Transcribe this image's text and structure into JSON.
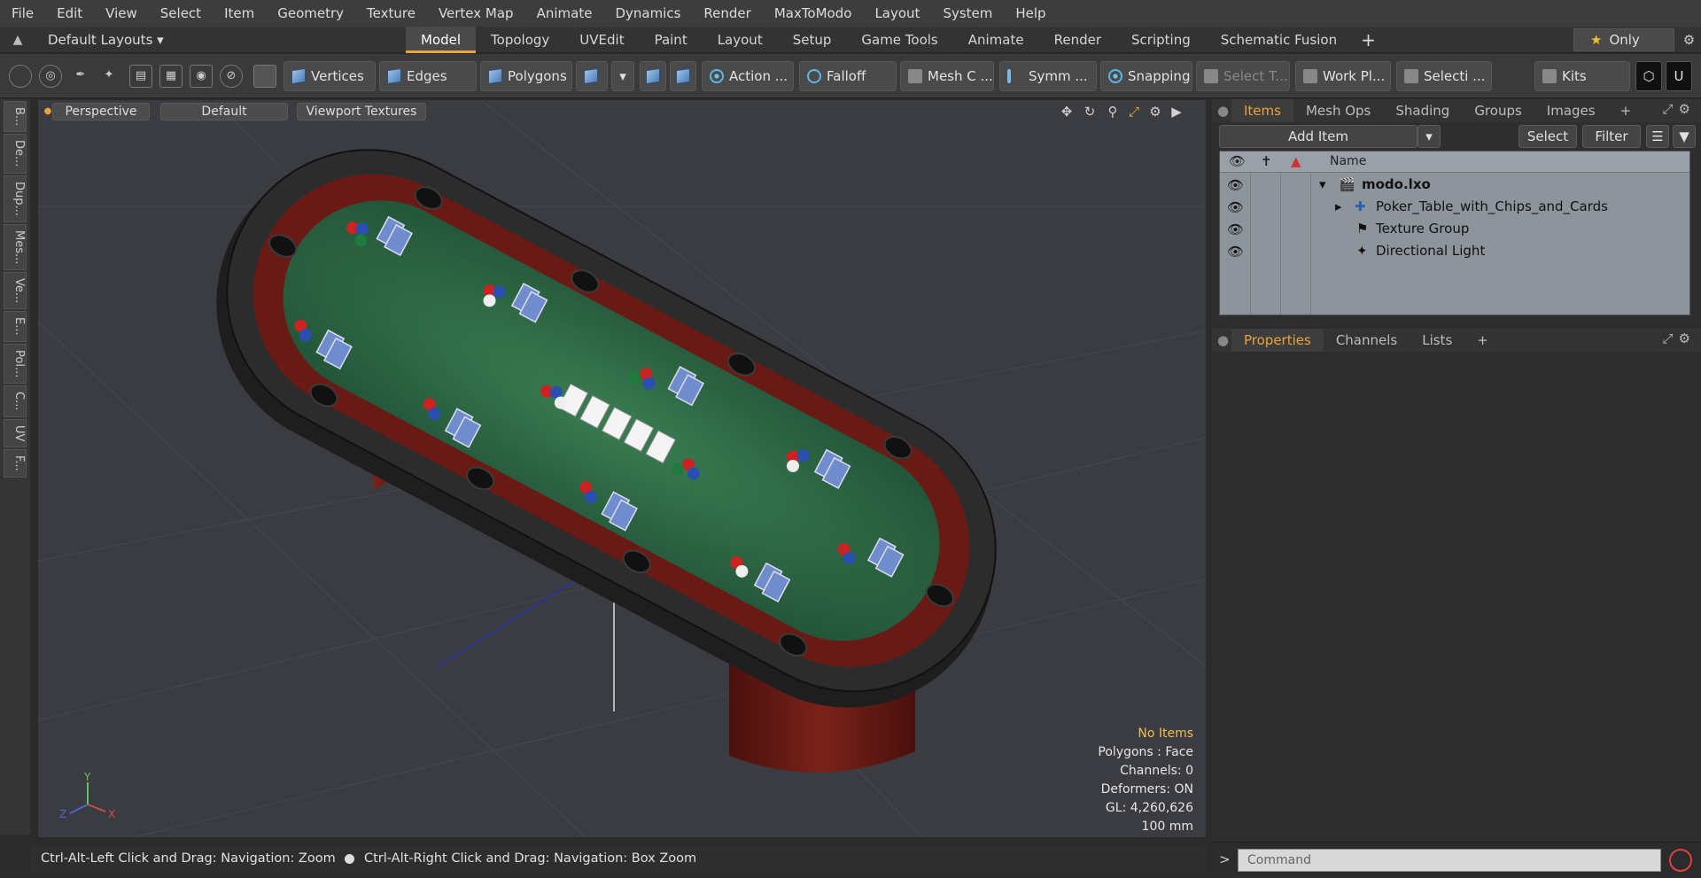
{
  "menu": [
    "File",
    "Edit",
    "View",
    "Select",
    "Item",
    "Geometry",
    "Texture",
    "Vertex Map",
    "Animate",
    "Dynamics",
    "Render",
    "MaxToModo",
    "Layout",
    "System",
    "Help"
  ],
  "layoutbar": {
    "layouts_label": "Default Layouts ▾",
    "tabs": [
      "Model",
      "Topology",
      "UVEdit",
      "Paint",
      "Layout",
      "Setup",
      "Game Tools",
      "Animate",
      "Render",
      "Scripting",
      "Schematic Fusion"
    ],
    "active_tab": "Model",
    "only_label": "Only"
  },
  "toolbar": {
    "vertices": "Vertices",
    "edges": "Edges",
    "polygons": "Polygons",
    "action": "Action",
    "falloff": "Falloff",
    "meshc": "Mesh C ...",
    "symm": "Symm ...",
    "snapping": "Snapping",
    "selectt": "Select T...",
    "workpl": "Work Pl...",
    "selecti": "Selecti ...",
    "kits": "Kits"
  },
  "lefttabs": [
    "B...",
    "De...",
    "Dup...",
    "Mes...",
    "Ve...",
    "E...",
    "Pol...",
    "C...",
    "UV",
    "F..."
  ],
  "viewport": {
    "perspective": "Perspective",
    "default": "Default",
    "textures": "Viewport Textures",
    "axis_x": "X",
    "axis_y": "Y",
    "axis_z": "Z",
    "info": {
      "no_items": "No Items",
      "polygons": "Polygons : Face",
      "channels": "Channels: 0",
      "deformers": "Deformers: ON",
      "gl": "GL: 4,260,626",
      "unit": "100 mm"
    }
  },
  "statusbar": {
    "left": "Ctrl-Alt-Left Click and Drag: Navigation: Zoom",
    "right": "Ctrl-Alt-Right Click and Drag: Navigation: Box Zoom"
  },
  "itemspanel": {
    "tabs": [
      "Items",
      "Mesh Ops",
      "Shading",
      "Groups",
      "Images"
    ],
    "active_tab": "Items",
    "add_item": "Add Item",
    "select": "Select",
    "filter": "Filter",
    "name_header": "Name",
    "rows": [
      {
        "label": "modo.lxo"
      },
      {
        "label": "Poker_Table_with_Chips_and_Cards"
      },
      {
        "label": "Texture Group"
      },
      {
        "label": "Directional Light"
      }
    ]
  },
  "propspanel": {
    "tabs": [
      "Properties",
      "Channels",
      "Lists"
    ],
    "active_tab": "Properties"
  },
  "command": {
    "prompt": ">",
    "placeholder": "Command"
  },
  "colors": {
    "accent": "#e8a33d",
    "felt": "#2e6b45",
    "wood": "#6a1a14",
    "rail": "#2a2a2a",
    "viewport_bg": "#3a3c41"
  }
}
